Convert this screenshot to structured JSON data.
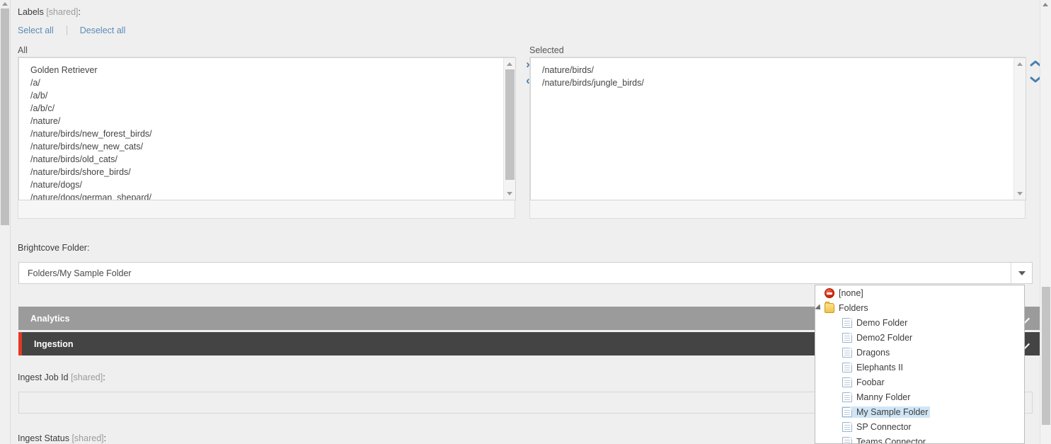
{
  "labels_section": {
    "title": "Labels",
    "shared_tag": "[shared]",
    "colon": ":",
    "select_all": "Select all",
    "deselect_all": "Deselect all",
    "all_header": "All",
    "selected_header": "Selected",
    "all_items": [
      "Golden Retriever",
      "/a/",
      "/a/b/",
      "/a/b/c/",
      "/nature/",
      "/nature/birds/new_forest_birds/",
      "/nature/birds/new_new_cats/",
      "/nature/birds/old_cats/",
      "/nature/birds/shore_birds/",
      "/nature/dogs/",
      "/nature/dogs/german_shepard/"
    ],
    "selected_items": [
      "/nature/birds/",
      "/nature/birds/jungle_birds/"
    ],
    "move_right_icon": "›",
    "move_left_icon": "‹",
    "reorder_up_icon": "⌃",
    "reorder_down_icon": "⌄"
  },
  "brightcove_folder": {
    "label": "Brightcove Folder:",
    "value": "Folders/My Sample Folder",
    "dropdown_icon": "caret-down-icon"
  },
  "tree_dropdown": {
    "items": [
      {
        "label": "[none]",
        "icon": "no-entry-icon",
        "level": 1,
        "selected": false,
        "expandable": false
      },
      {
        "label": "Folders",
        "icon": "folder-icon",
        "level": 1,
        "selected": false,
        "expandable": true
      },
      {
        "label": "Demo Folder",
        "icon": "page-icon",
        "level": 2,
        "selected": false,
        "expandable": false
      },
      {
        "label": "Demo2 Folder",
        "icon": "page-icon",
        "level": 2,
        "selected": false,
        "expandable": false
      },
      {
        "label": "Dragons",
        "icon": "page-icon",
        "level": 2,
        "selected": false,
        "expandable": false
      },
      {
        "label": "Elephants II",
        "icon": "page-icon",
        "level": 2,
        "selected": false,
        "expandable": false
      },
      {
        "label": "Foobar",
        "icon": "page-icon",
        "level": 2,
        "selected": false,
        "expandable": false
      },
      {
        "label": "Manny Folder",
        "icon": "page-icon",
        "level": 2,
        "selected": false,
        "expandable": false
      },
      {
        "label": "My Sample Folder",
        "icon": "page-icon",
        "level": 2,
        "selected": true,
        "expandable": false
      },
      {
        "label": "SP Connector",
        "icon": "page-icon",
        "level": 2,
        "selected": false,
        "expandable": false
      },
      {
        "label": "Teams Connector",
        "icon": "page-icon",
        "level": 2,
        "selected": false,
        "expandable": false
      }
    ]
  },
  "sections": [
    {
      "title": "Analytics",
      "accent": "",
      "background": "#9b9b9b"
    },
    {
      "title": "Ingestion",
      "accent": "#e03a23",
      "background": "#444444"
    }
  ],
  "ingestion": {
    "job_id_label": "Ingest Job Id",
    "job_id_shared": "[shared]",
    "job_id_value": "",
    "status_label": "Ingest Status",
    "status_shared": "[shared]"
  },
  "colors": {
    "link_blue": "#5b8cb8",
    "arrow_blue": "#4a7fae",
    "analytics_header": "#9b9b9b",
    "ingestion_header": "#444444",
    "ingestion_accent": "#e03a23",
    "selection_highlight": "#cfe6f7",
    "page_background": "#efefef"
  }
}
